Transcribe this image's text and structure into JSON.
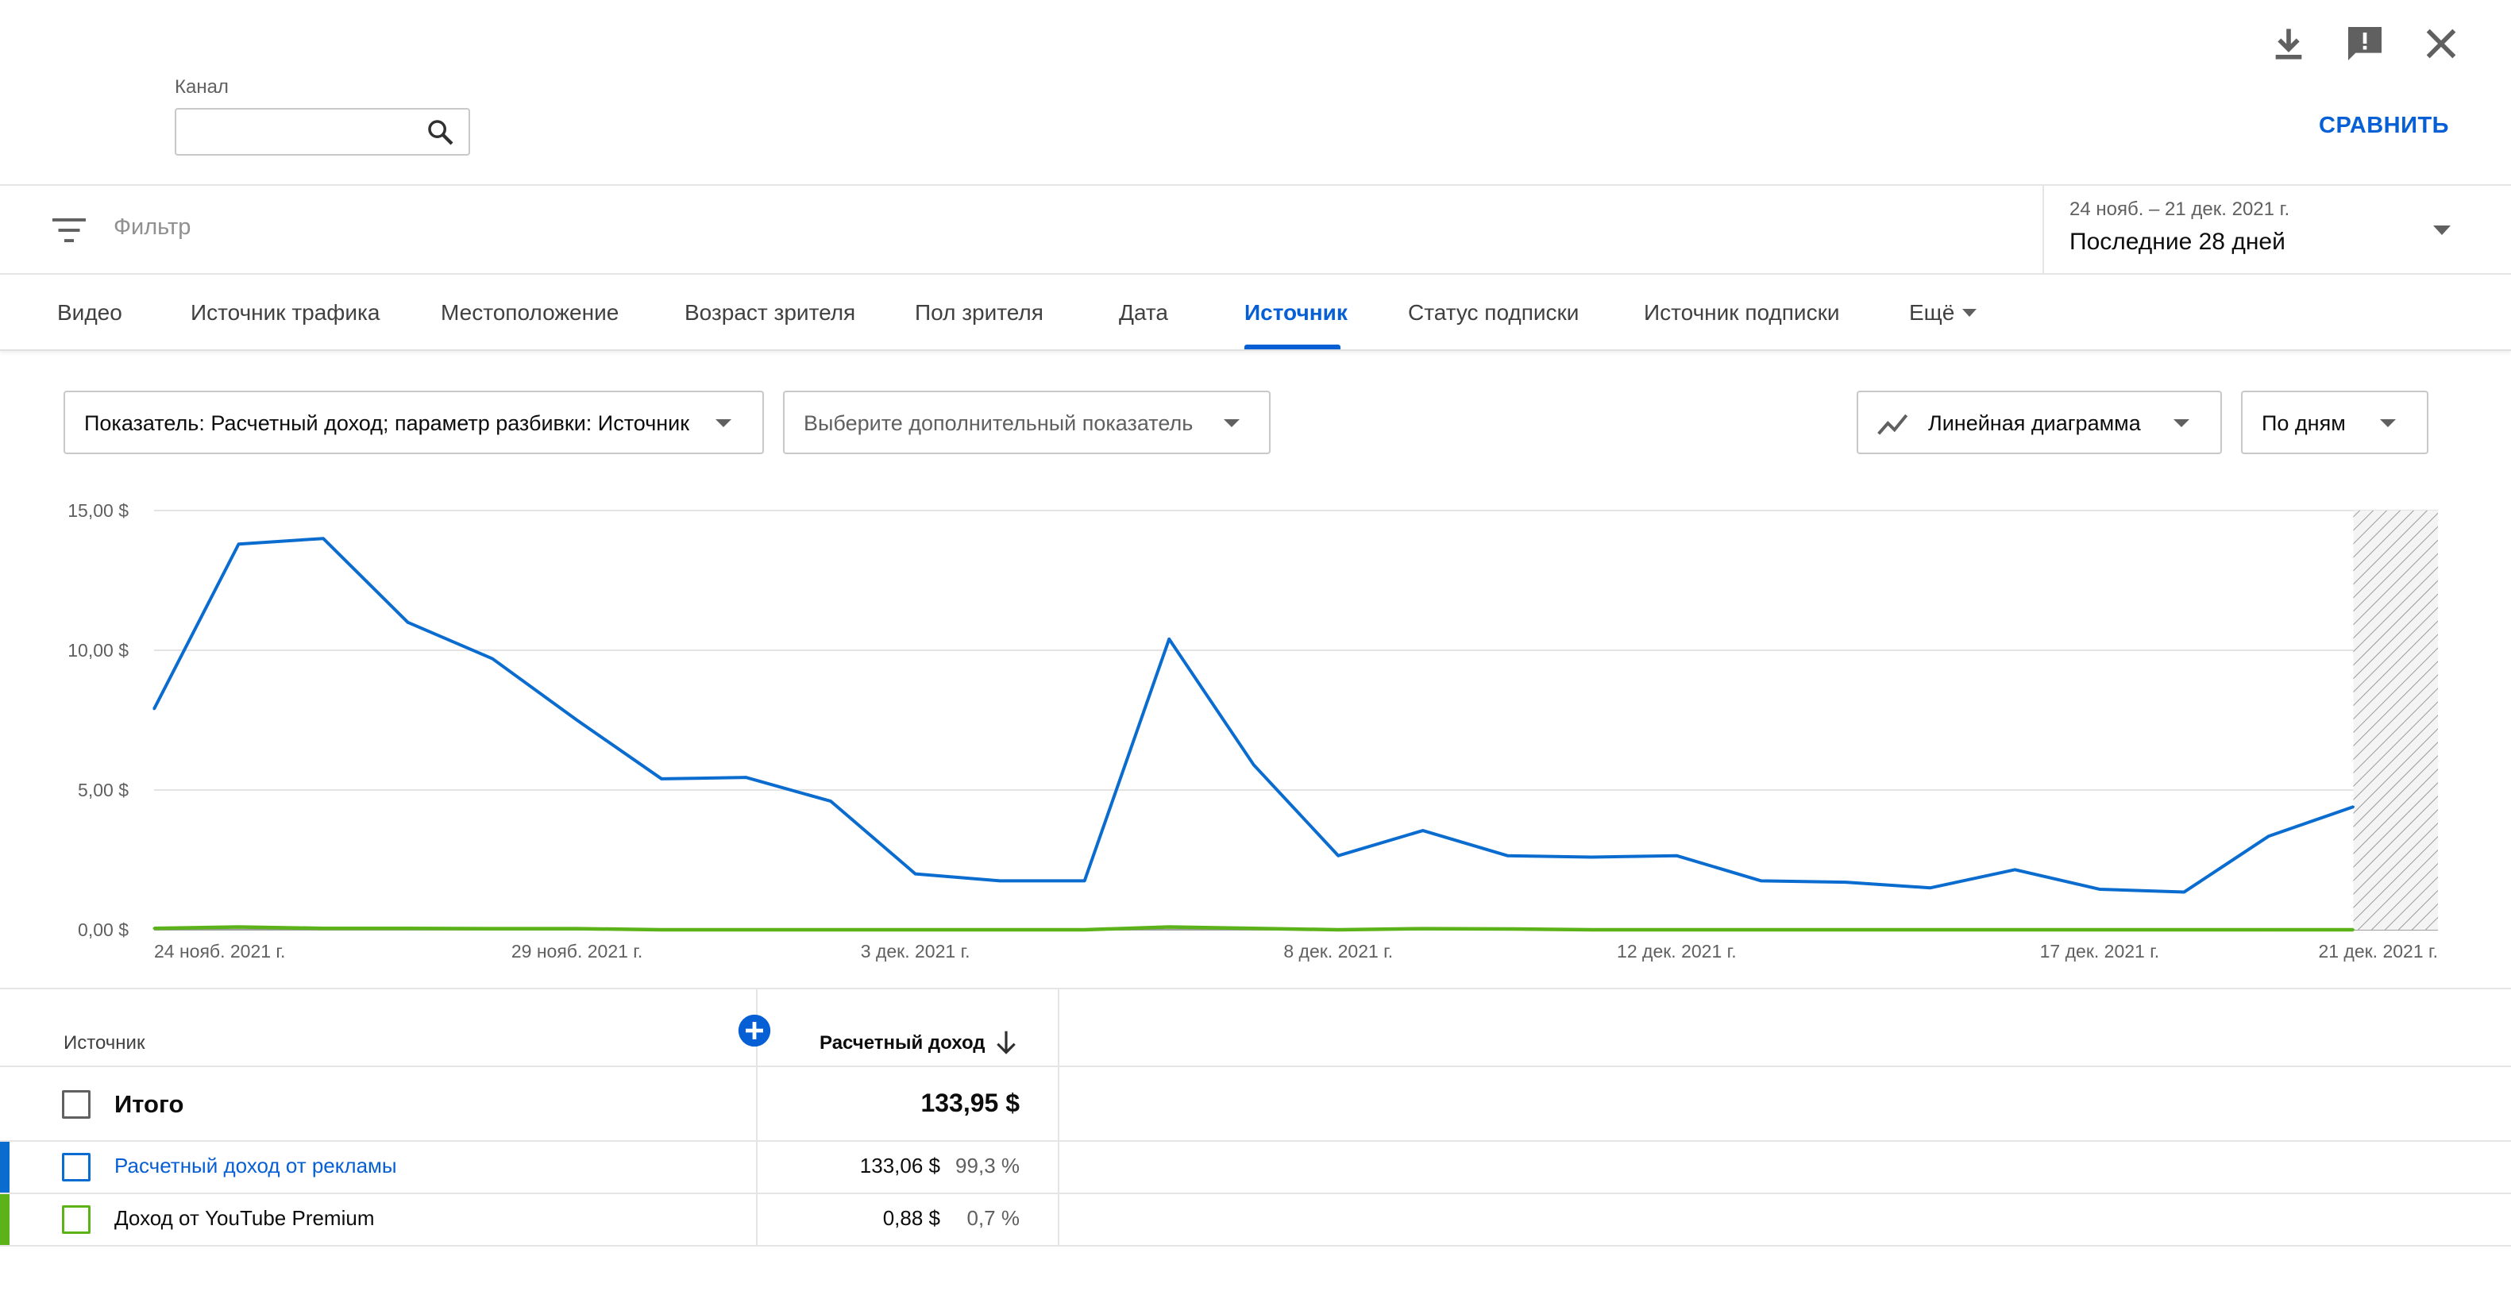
{
  "header": {
    "channel_label": "Канал",
    "channel_value": "",
    "compare_label": "СРАВНИТЬ",
    "icons": [
      "download-icon",
      "feedback-icon",
      "close-icon"
    ]
  },
  "filter": {
    "placeholder": "Фильтр",
    "date_range": "24 нояб. – 21 дек. 2021 г.",
    "period": "Последние 28 дней"
  },
  "tabs": [
    {
      "label": "Видео"
    },
    {
      "label": "Источник трафика"
    },
    {
      "label": "Местоположение"
    },
    {
      "label": "Возраст зрителя"
    },
    {
      "label": "Пол зрителя"
    },
    {
      "label": "Дата"
    },
    {
      "label": "Источник",
      "active": true
    },
    {
      "label": "Статус подписки"
    },
    {
      "label": "Источник подписки"
    },
    {
      "label": "Ещё"
    }
  ],
  "selectors": {
    "metric": "Показатель: Расчетный доход; параметр разбивки: Источник",
    "extra_metric": "Выберите дополнительный показатель",
    "chart_type": "Линейная диаграмма",
    "granularity": "По дням"
  },
  "colors": {
    "accent": "#065fd4",
    "series_ads": "#0a6ccf",
    "series_premium": "#5cb319"
  },
  "chart_data": {
    "type": "line",
    "x": [
      "24 нояб. 2021 г.",
      "25 нояб.",
      "26 нояб.",
      "27 нояб.",
      "28 нояб.",
      "29 нояб. 2021 г.",
      "30 нояб.",
      "1 дек.",
      "2 дек.",
      "3 дек. 2021 г.",
      "4 дек.",
      "5 дек.",
      "6 дек.",
      "7 дек.",
      "8 дек. 2021 г.",
      "9 дек.",
      "10 дек.",
      "11 дек.",
      "12 дек. 2021 г.",
      "13 дек.",
      "14 дек.",
      "15 дек.",
      "16 дек.",
      "17 дек. 2021 г.",
      "18 дек.",
      "19 дек.",
      "20 дек.",
      "21 дек. 2021 г."
    ],
    "tick_labels": [
      "24 нояб. 2021 г.",
      "29 нояб. 2021 г.",
      "3 дек. 2021 г.",
      "8 дек. 2021 г.",
      "12 дек. 2021 г.",
      "17 дек. 2021 г.",
      "21 дек. 2021 г."
    ],
    "tick_indices": [
      0,
      5,
      9,
      14,
      18,
      23,
      27
    ],
    "y_tick_labels": [
      "0,00 $",
      "5,00 $",
      "10,00 $",
      "15,00 $"
    ],
    "ylim": [
      0,
      15
    ],
    "grid": true,
    "hatched_last_day": true,
    "series": [
      {
        "name": "Расчетный доход от рекламы",
        "color": "#0a6ccf",
        "values": [
          7.9,
          13.8,
          14.0,
          11.0,
          9.7,
          7.5,
          5.4,
          5.45,
          4.6,
          2.0,
          1.75,
          1.75,
          10.4,
          5.9,
          2.65,
          3.55,
          2.65,
          2.6,
          2.65,
          1.75,
          1.7,
          1.5,
          2.15,
          1.45,
          1.35,
          3.35,
          4.4,
          null
        ]
      },
      {
        "name": "Доход от YouTube Premium",
        "color": "#5cb319",
        "values": [
          0.05,
          0.1,
          0.05,
          0.05,
          0.04,
          0.04,
          0.0,
          0.0,
          0.0,
          0.0,
          0.0,
          0.0,
          0.1,
          0.05,
          0.0,
          0.04,
          0.03,
          0.0,
          0.0,
          0.0,
          0.0,
          0.0,
          0.0,
          0.0,
          0.0,
          0.0,
          0.0,
          null
        ]
      }
    ]
  },
  "table": {
    "header_source": "Источник",
    "header_revenue": "Расчетный доход",
    "total_label": "Итого",
    "total_value": "133,95 $",
    "rows": [
      {
        "label": "Расчетный доход от рекламы",
        "value": "133,06 $",
        "pct": "99,3 %",
        "color": "#0a6ccf"
      },
      {
        "label": "Доход от YouTube Premium",
        "value": "0,88 $",
        "pct": "0,7 %",
        "color": "#5cb319"
      }
    ]
  }
}
